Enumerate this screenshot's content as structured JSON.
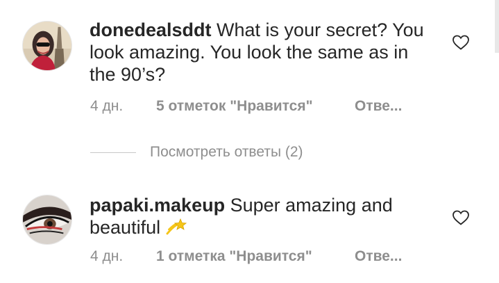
{
  "comments": [
    {
      "username": "donedealsddt",
      "text": "What is your secret? You look amazing. You look the same as in the 90’s?",
      "time": "4 дн.",
      "likes": "5 отметок \"Нравится\"",
      "reply": "Отве..."
    },
    {
      "username": "papaki.makeup",
      "text": "Super amazing and beautiful",
      "emoji": "dizzy-star-emoji",
      "time": "4 дн.",
      "likes": "1 отметка \"Нравится\"",
      "reply": "Отве..."
    }
  ],
  "view_replies": "Посмотреть ответы (2)",
  "icons": {
    "like": "heart-outline-icon"
  },
  "colors": {
    "text": "#262626",
    "muted": "#8e8e8e",
    "divider": "#c7c7c7"
  }
}
